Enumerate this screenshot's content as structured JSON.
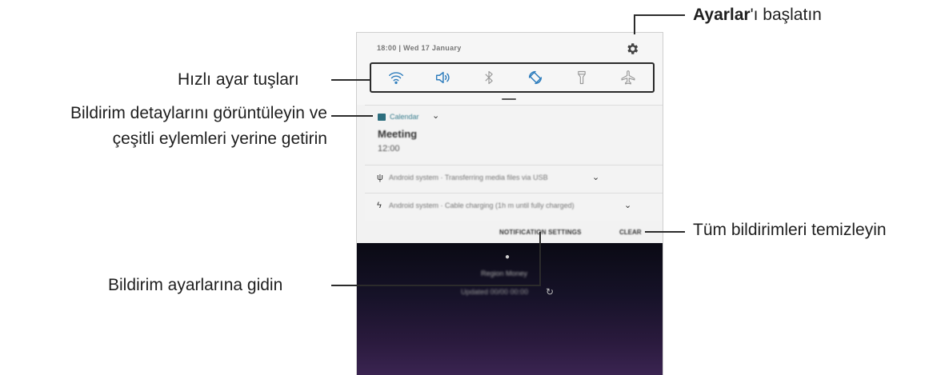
{
  "callouts": {
    "settings": {
      "bold": "Ayarlar",
      "rest": "'ı başlatın"
    },
    "quick_settings": "Hızlı ayar tuşları",
    "notif_details_line1": "Bildirim detaylarını görüntüleyin ve",
    "notif_details_line2": "çeşitli eylemleri yerine getirin",
    "clear_all": "Tüm bildirimleri temizleyin",
    "notif_settings": "Bildirim ayarlarına gidin"
  },
  "phone": {
    "status_bar": {
      "time_date": "18:00 | Wed 17 January"
    },
    "quick_settings": [
      {
        "name": "wifi-icon"
      },
      {
        "name": "sound-icon"
      },
      {
        "name": "bluetooth-icon"
      },
      {
        "name": "auto-rotate-icon"
      },
      {
        "name": "flashlight-icon"
      },
      {
        "name": "airplane-mode-icon"
      }
    ],
    "notification": {
      "app": "Calendar",
      "title": "Meeting",
      "time": "12:00"
    },
    "rows": [
      {
        "icon": "ψ",
        "text": "Android system · Transferring media files via USB"
      },
      {
        "icon": "ϟ",
        "text": "Android system · Cable charging (1h m until fully charged)"
      }
    ],
    "actions": {
      "settings": "NOTIFICATION SETTINGS",
      "clear": "CLEAR"
    },
    "lockscreen": {
      "location": "Region Money",
      "updated": "Updated 00/00 00:00"
    }
  },
  "colors": {
    "accent": "#2d6e7e",
    "lockscreen_bottom": "#3a2451"
  }
}
